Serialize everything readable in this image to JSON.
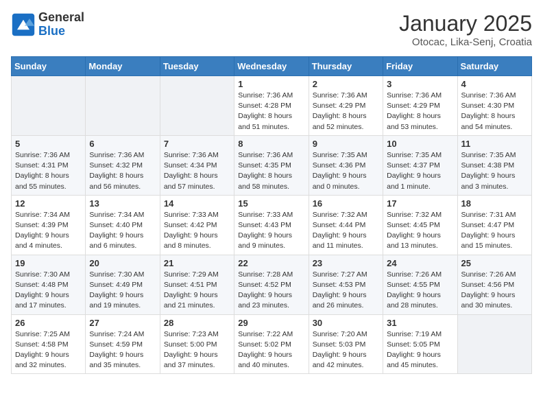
{
  "header": {
    "logo_general": "General",
    "logo_blue": "Blue",
    "month": "January 2025",
    "location": "Otocac, Lika-Senj, Croatia"
  },
  "weekdays": [
    "Sunday",
    "Monday",
    "Tuesday",
    "Wednesday",
    "Thursday",
    "Friday",
    "Saturday"
  ],
  "weeks": [
    [
      {
        "day": "",
        "info": ""
      },
      {
        "day": "",
        "info": ""
      },
      {
        "day": "",
        "info": ""
      },
      {
        "day": "1",
        "info": "Sunrise: 7:36 AM\nSunset: 4:28 PM\nDaylight: 8 hours and 51 minutes."
      },
      {
        "day": "2",
        "info": "Sunrise: 7:36 AM\nSunset: 4:29 PM\nDaylight: 8 hours and 52 minutes."
      },
      {
        "day": "3",
        "info": "Sunrise: 7:36 AM\nSunset: 4:29 PM\nDaylight: 8 hours and 53 minutes."
      },
      {
        "day": "4",
        "info": "Sunrise: 7:36 AM\nSunset: 4:30 PM\nDaylight: 8 hours and 54 minutes."
      }
    ],
    [
      {
        "day": "5",
        "info": "Sunrise: 7:36 AM\nSunset: 4:31 PM\nDaylight: 8 hours and 55 minutes."
      },
      {
        "day": "6",
        "info": "Sunrise: 7:36 AM\nSunset: 4:32 PM\nDaylight: 8 hours and 56 minutes."
      },
      {
        "day": "7",
        "info": "Sunrise: 7:36 AM\nSunset: 4:34 PM\nDaylight: 8 hours and 57 minutes."
      },
      {
        "day": "8",
        "info": "Sunrise: 7:36 AM\nSunset: 4:35 PM\nDaylight: 8 hours and 58 minutes."
      },
      {
        "day": "9",
        "info": "Sunrise: 7:35 AM\nSunset: 4:36 PM\nDaylight: 9 hours and 0 minutes."
      },
      {
        "day": "10",
        "info": "Sunrise: 7:35 AM\nSunset: 4:37 PM\nDaylight: 9 hours and 1 minute."
      },
      {
        "day": "11",
        "info": "Sunrise: 7:35 AM\nSunset: 4:38 PM\nDaylight: 9 hours and 3 minutes."
      }
    ],
    [
      {
        "day": "12",
        "info": "Sunrise: 7:34 AM\nSunset: 4:39 PM\nDaylight: 9 hours and 4 minutes."
      },
      {
        "day": "13",
        "info": "Sunrise: 7:34 AM\nSunset: 4:40 PM\nDaylight: 9 hours and 6 minutes."
      },
      {
        "day": "14",
        "info": "Sunrise: 7:33 AM\nSunset: 4:42 PM\nDaylight: 9 hours and 8 minutes."
      },
      {
        "day": "15",
        "info": "Sunrise: 7:33 AM\nSunset: 4:43 PM\nDaylight: 9 hours and 9 minutes."
      },
      {
        "day": "16",
        "info": "Sunrise: 7:32 AM\nSunset: 4:44 PM\nDaylight: 9 hours and 11 minutes."
      },
      {
        "day": "17",
        "info": "Sunrise: 7:32 AM\nSunset: 4:45 PM\nDaylight: 9 hours and 13 minutes."
      },
      {
        "day": "18",
        "info": "Sunrise: 7:31 AM\nSunset: 4:47 PM\nDaylight: 9 hours and 15 minutes."
      }
    ],
    [
      {
        "day": "19",
        "info": "Sunrise: 7:30 AM\nSunset: 4:48 PM\nDaylight: 9 hours and 17 minutes."
      },
      {
        "day": "20",
        "info": "Sunrise: 7:30 AM\nSunset: 4:49 PM\nDaylight: 9 hours and 19 minutes."
      },
      {
        "day": "21",
        "info": "Sunrise: 7:29 AM\nSunset: 4:51 PM\nDaylight: 9 hours and 21 minutes."
      },
      {
        "day": "22",
        "info": "Sunrise: 7:28 AM\nSunset: 4:52 PM\nDaylight: 9 hours and 23 minutes."
      },
      {
        "day": "23",
        "info": "Sunrise: 7:27 AM\nSunset: 4:53 PM\nDaylight: 9 hours and 26 minutes."
      },
      {
        "day": "24",
        "info": "Sunrise: 7:26 AM\nSunset: 4:55 PM\nDaylight: 9 hours and 28 minutes."
      },
      {
        "day": "25",
        "info": "Sunrise: 7:26 AM\nSunset: 4:56 PM\nDaylight: 9 hours and 30 minutes."
      }
    ],
    [
      {
        "day": "26",
        "info": "Sunrise: 7:25 AM\nSunset: 4:58 PM\nDaylight: 9 hours and 32 minutes."
      },
      {
        "day": "27",
        "info": "Sunrise: 7:24 AM\nSunset: 4:59 PM\nDaylight: 9 hours and 35 minutes."
      },
      {
        "day": "28",
        "info": "Sunrise: 7:23 AM\nSunset: 5:00 PM\nDaylight: 9 hours and 37 minutes."
      },
      {
        "day": "29",
        "info": "Sunrise: 7:22 AM\nSunset: 5:02 PM\nDaylight: 9 hours and 40 minutes."
      },
      {
        "day": "30",
        "info": "Sunrise: 7:20 AM\nSunset: 5:03 PM\nDaylight: 9 hours and 42 minutes."
      },
      {
        "day": "31",
        "info": "Sunrise: 7:19 AM\nSunset: 5:05 PM\nDaylight: 9 hours and 45 minutes."
      },
      {
        "day": "",
        "info": ""
      }
    ]
  ]
}
